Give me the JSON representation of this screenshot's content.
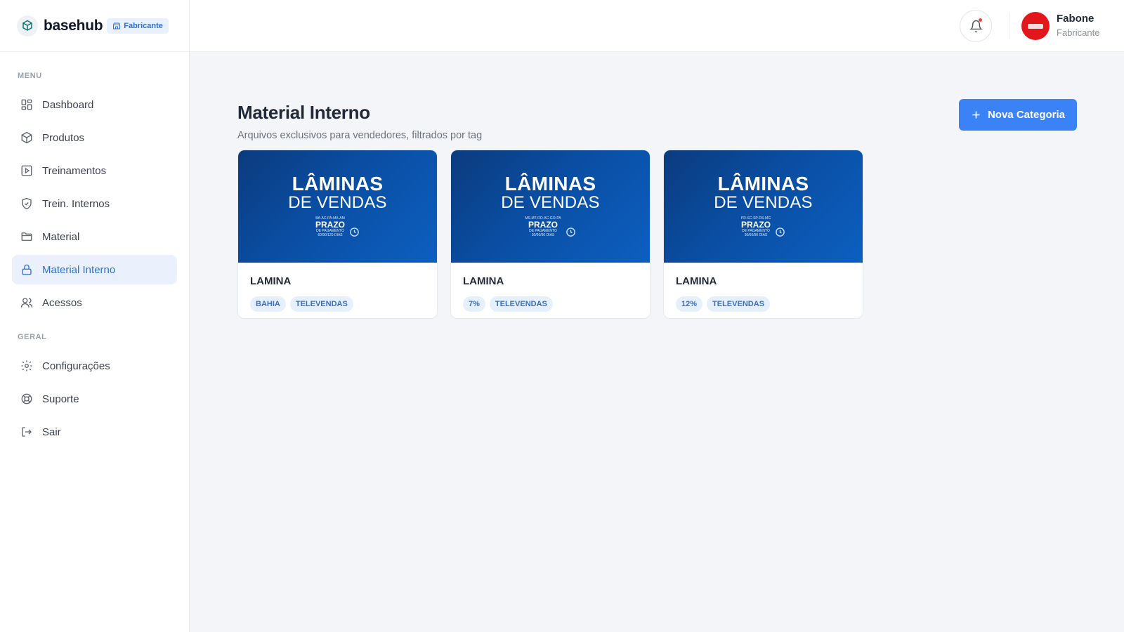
{
  "brand": {
    "name": "basehub",
    "badge": "Fabricante"
  },
  "sidebar": {
    "menu_label": "MENU",
    "items": [
      {
        "label": "Dashboard",
        "icon": "dashboard-icon"
      },
      {
        "label": "Produtos",
        "icon": "box-icon"
      },
      {
        "label": "Treinamentos",
        "icon": "play-square-icon"
      },
      {
        "label": "Trein. Internos",
        "icon": "shield-check-icon"
      },
      {
        "label": "Material",
        "icon": "folder-icon"
      },
      {
        "label": "Material Interno",
        "icon": "lock-icon",
        "active": true
      },
      {
        "label": "Acessos",
        "icon": "users-icon"
      }
    ],
    "geral_label": "GERAL",
    "geral_items": [
      {
        "label": "Configurações",
        "icon": "gear-icon"
      },
      {
        "label": "Suporte",
        "icon": "lifebuoy-icon"
      },
      {
        "label": "Sair",
        "icon": "logout-icon"
      }
    ]
  },
  "header": {
    "user": {
      "name": "Fabone",
      "role": "Fabricante"
    }
  },
  "main": {
    "title": "Material Interno",
    "subtitle": "Arquivos exclusivos para vendedores, filtrados por tag",
    "new_button": "Nova Categoria",
    "cards": [
      {
        "thumb": {
          "line1": "LÂMINAS",
          "line2": "DE VENDAS",
          "small": "BA-AC-PA-MA-AM",
          "prazo": "PRAZO",
          "prazo_sub": "DE PAGAMENTO",
          "prazo_days": "60/90/120 DIAS"
        },
        "title": "LAMINA",
        "tags": [
          "BAHIA",
          "TELEVENDAS"
        ]
      },
      {
        "thumb": {
          "line1": "LÂMINAS",
          "line2": "DE VENDAS",
          "small": "MS-MT-RO-AC-GO-PA",
          "prazo": "PRAZO",
          "prazo_sub": "DE PAGAMENTO",
          "prazo_days": "30/60/90 DIAS"
        },
        "title": "LAMINA",
        "tags": [
          "7%",
          "TELEVENDAS"
        ]
      },
      {
        "thumb": {
          "line1": "LÂMINAS",
          "line2": "DE VENDAS",
          "small": "PR-SC-SP-RS-MG",
          "prazo": "PRAZO",
          "prazo_sub": "DE PAGAMENTO",
          "prazo_days": "30/60/90 DIAS"
        },
        "title": "LAMINA",
        "tags": [
          "12%",
          "TELEVENDAS"
        ]
      }
    ]
  },
  "colors": {
    "accent": "#3b82f6",
    "active_bg": "#eaf1fd",
    "banner": "#0a4ea3",
    "avatar": "#e3171b"
  }
}
